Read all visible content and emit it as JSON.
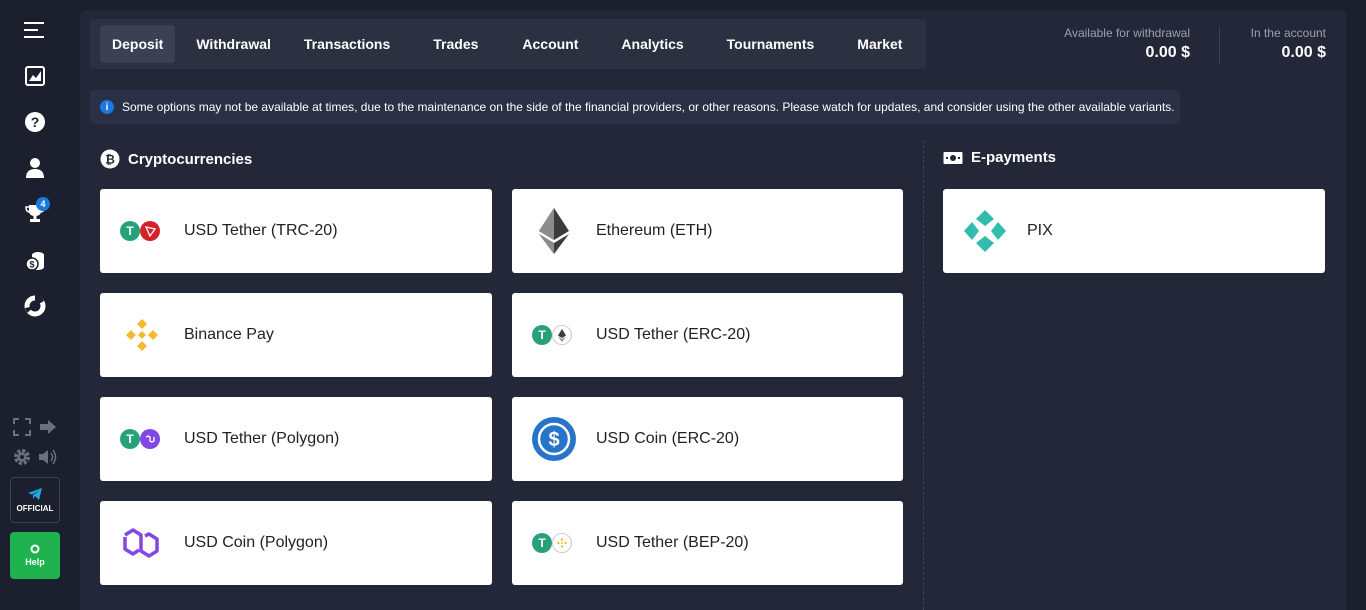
{
  "tabs": [
    {
      "label": "Deposit",
      "active": true
    },
    {
      "label": "Withdrawal"
    },
    {
      "label": "Transactions"
    },
    {
      "label": "Trades"
    },
    {
      "label": "Account"
    },
    {
      "label": "Analytics"
    },
    {
      "label": "Tournaments"
    },
    {
      "label": "Market"
    }
  ],
  "balance": {
    "withdrawal_label": "Available for withdrawal",
    "withdrawal_value": "0.00 $",
    "account_label": "In the account",
    "account_value": "0.00 $"
  },
  "notice": {
    "icon": "info-icon",
    "text": "Some options may not be available at times, due to the maintenance on the side of the financial providers, or other reasons. Please watch for updates, and consider using the other available variants."
  },
  "sidebar": {
    "trophy_badge": "4",
    "official_label": "OFFICIAL",
    "help_label": "Help"
  },
  "crypto": {
    "title": "Cryptocurrencies",
    "items": [
      {
        "label": "USD Tether (TRC-20)"
      },
      {
        "label": "Ethereum (ETH)"
      },
      {
        "label": "Binance Pay"
      },
      {
        "label": "USD Tether (ERC-20)"
      },
      {
        "label": "USD Tether (Polygon)"
      },
      {
        "label": "USD Coin (ERC-20)"
      },
      {
        "label": "USD Coin (Polygon)"
      },
      {
        "label": "USD Tether (BEP-20)"
      }
    ]
  },
  "epayments": {
    "title": "E-payments",
    "items": [
      {
        "label": "PIX"
      }
    ]
  },
  "colors": {
    "bg": "#1c1f2d",
    "panel": "#232738",
    "accent": "#1b78e2",
    "help_green": "#1fb34f",
    "tether": "#26a17b"
  }
}
